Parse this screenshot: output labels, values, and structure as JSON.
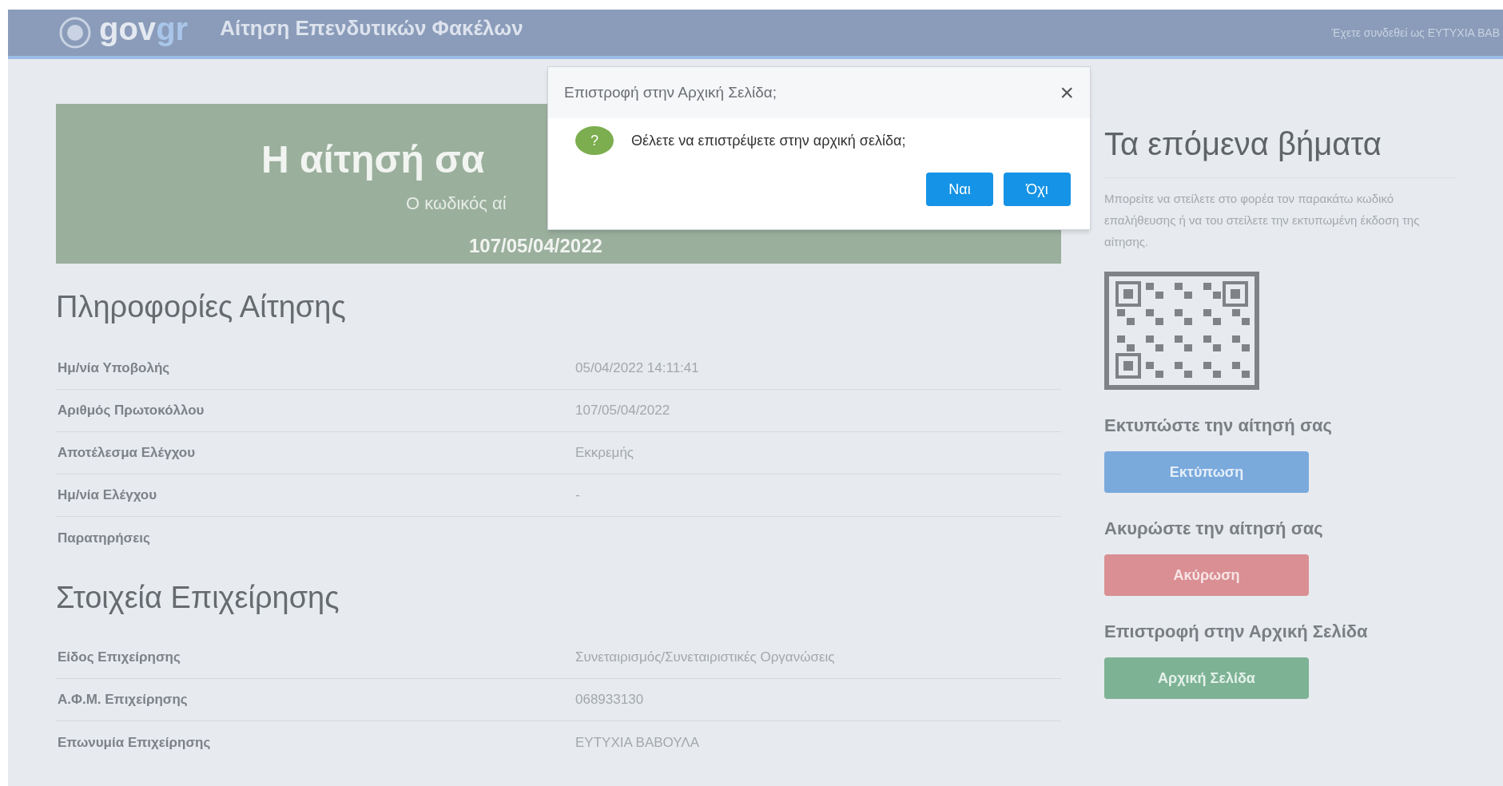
{
  "header": {
    "logo": {
      "primary": "gov",
      "accent": "gr"
    },
    "title": "Αίτηση Επενδυτικών Φακέλων",
    "user": "Έχετε συνδεθεί ως ΕΥΤΥΧΙΑ ΒΑΒ"
  },
  "banner": {
    "title": "Η αίτησή σα",
    "subtitle": "Ο κωδικός αί",
    "code": "107/05/04/2022"
  },
  "sections": [
    {
      "heading": "Πληροφορίες Αίτησης",
      "rows": [
        {
          "label": "Ημ/νία Υποβολής",
          "value": "05/04/2022 14:11:41"
        },
        {
          "label": "Αριθμός Πρωτοκόλλου",
          "value": "107/05/04/2022"
        },
        {
          "label": "Αποτέλεσμα Ελέγχου",
          "value": "Εκκρεμής"
        },
        {
          "label": "Ημ/νία Ελέγχου",
          "value": "-"
        },
        {
          "label": "Παρατηρήσεις"
        }
      ]
    },
    {
      "heading": "Στοιχεία Επιχείρησης",
      "rows": [
        {
          "label": "Είδος Επιχείρησης",
          "value": "Συνεταιρισμός/Συνεταιριστικές Οργανώσεις"
        },
        {
          "label": "Α.Φ.Μ. Επιχείρησης",
          "value": "068933130"
        },
        {
          "label": "Επωνυμία Επιχείρησης",
          "value": "ΕΥΤΥΧΙΑ ΒΑΒΟΥΛΑ"
        }
      ]
    }
  ],
  "next_steps": {
    "heading": "Τα επόμενα βήματα",
    "text": "Μπορείτε να στείλετε στο φορέα τον παρακάτω κωδικό επαλήθευσης ή να του στείλετε την εκτυπωμένη έκδοση της αίτησης.",
    "actions": [
      {
        "kind": "print",
        "heading": "Εκτυπώστε την αίτησή σας",
        "button": "Εκτύπωση"
      },
      {
        "kind": "cancel",
        "heading": "Ακυρώστε την αίτησή σας",
        "button": "Ακύρωση"
      },
      {
        "kind": "home",
        "heading": "Επιστροφή στην Αρχική Σελίδα",
        "button": "Αρχική Σελίδα"
      }
    ]
  },
  "dialog": {
    "title": "Επιστροφή στην Αρχική Σελίδα;",
    "close": "×",
    "icon": "?",
    "message": "Θέλετε να επιστρέψετε στην αρχική σελίδα;",
    "buttons": [
      "Ναι",
      "Όχι"
    ]
  }
}
